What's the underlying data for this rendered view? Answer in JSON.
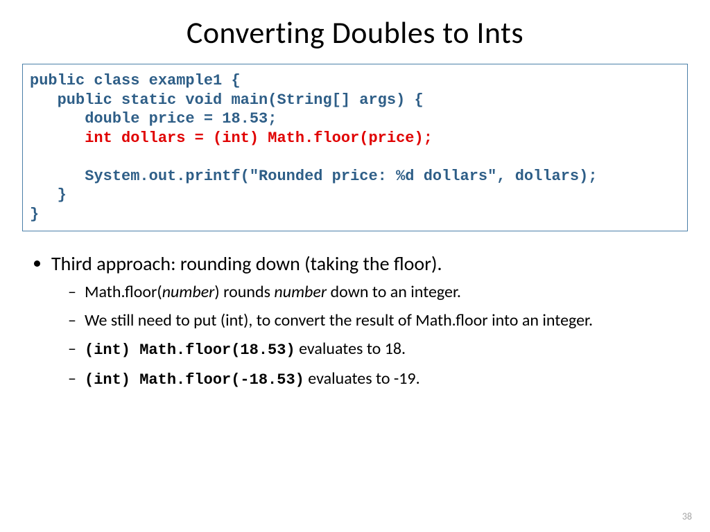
{
  "title": "Converting Doubles to Ints",
  "code": {
    "l1": "public class example1 {",
    "l2": "   public static void main(String[] args) {",
    "l3": "      double price = 18.53;",
    "l4": "      int dollars = (int) Math.floor(price);",
    "l5": "",
    "l6": "      System.out.printf(\"Rounded price: %d dollars\", dollars);",
    "l7": "   }",
    "l8": "}"
  },
  "bullets": {
    "b1": "Third approach: rounding down (taking the floor).",
    "s1a": "Math.floor(",
    "s1b": "number",
    "s1c": ") rounds ",
    "s1d": "number",
    "s1e": " down to an integer.",
    "s2": "We still need to put (int), to convert the result of Math.floor into an integer.",
    "s3a": "(int) Math.floor(18.53)",
    "s3b": "  evaluates to 18.",
    "s4a": "(int) Math.floor(-18.53)",
    "s4b": "  evaluates to -19."
  },
  "pageNumber": "38"
}
